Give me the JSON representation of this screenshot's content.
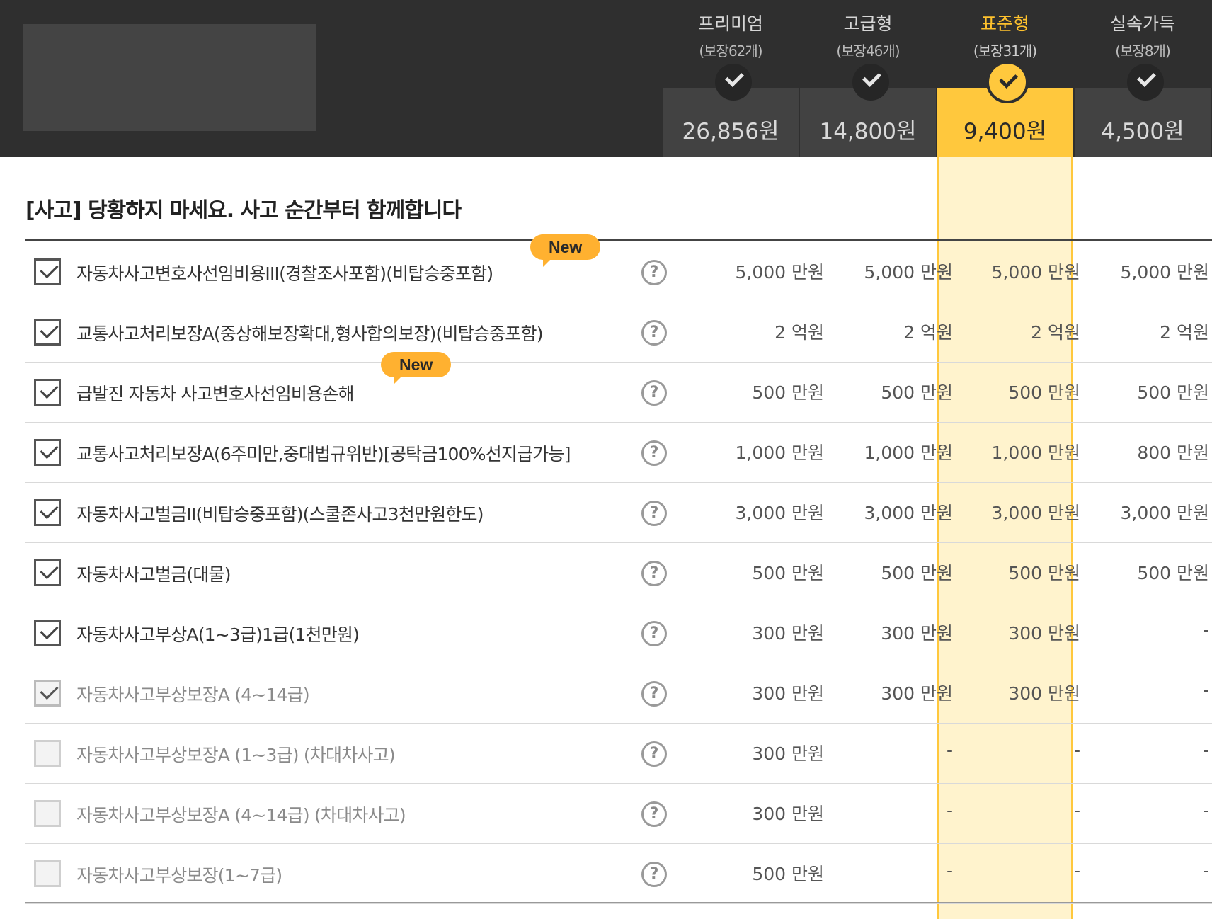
{
  "plans": [
    {
      "name": "프리미엄",
      "count": "(보장62개)",
      "price": "26,856원"
    },
    {
      "name": "고급형",
      "count": "(보장46개)",
      "price": "14,800원"
    },
    {
      "name": "표준형",
      "count": "(보장31개)",
      "price": "9,400원"
    },
    {
      "name": "실속가득",
      "count": "(보장8개)",
      "price": "4,500원"
    }
  ],
  "selected_plan": "표준형",
  "section_title": "[사고] 당황하지 마세요. 사고 순간부터 함께합니다",
  "badge_new": "New",
  "help_symbol": "?",
  "rows": [
    {
      "label": "자동차사고변호사선임비용III(경찰조사포함)(비탑승중포함)",
      "values": [
        "5,000 만원",
        "5,000 만원",
        "5,000 만원",
        "5,000 만원"
      ],
      "checked": true,
      "new": true
    },
    {
      "label": "교통사고처리보장A(중상해보장확대,형사합의보장)(비탑승중포함)",
      "values": [
        "2 억원",
        "2 억원",
        "2 억원",
        "2 억원"
      ],
      "checked": true,
      "new": false
    },
    {
      "label": "급발진 자동차 사고변호사선임비용손해",
      "values": [
        "500 만원",
        "500 만원",
        "500 만원",
        "500 만원"
      ],
      "checked": true,
      "new": true
    },
    {
      "label": "교통사고처리보장A(6주미만,중대법규위반)[공탁금100%선지급가능]",
      "values": [
        "1,000 만원",
        "1,000 만원",
        "1,000 만원",
        "800 만원"
      ],
      "checked": true,
      "new": false
    },
    {
      "label": "자동차사고벌금II(비탑승중포함)(스쿨존사고3천만원한도)",
      "values": [
        "3,000 만원",
        "3,000 만원",
        "3,000 만원",
        "3,000 만원"
      ],
      "checked": true,
      "new": false
    },
    {
      "label": "자동차사고벌금(대물)",
      "values": [
        "500 만원",
        "500 만원",
        "500 만원",
        "500 만원"
      ],
      "checked": true,
      "new": false
    },
    {
      "label": "자동차사고부상A(1~3급)1급(1천만원)",
      "values": [
        "300 만원",
        "300 만원",
        "300 만원",
        "-"
      ],
      "checked": true,
      "new": false
    },
    {
      "label": "자동차사고부상보장A (4~14급)",
      "values": [
        "300 만원",
        "300 만원",
        "300 만원",
        "-"
      ],
      "checked": "light",
      "new": false
    },
    {
      "label": "자동차사고부상보장A (1~3급) (차대차사고)",
      "values": [
        "300 만원",
        "-",
        "-",
        "-"
      ],
      "checked": false,
      "new": false
    },
    {
      "label": "자동차사고부상보장A (4~14급) (차대차사고)",
      "values": [
        "300 만원",
        "-",
        "-",
        "-"
      ],
      "checked": false,
      "new": false
    },
    {
      "label": "자동차사고부상보장(1~7급)",
      "values": [
        "500 만원",
        "-",
        "-",
        "-"
      ],
      "checked": false,
      "new": false
    }
  ]
}
